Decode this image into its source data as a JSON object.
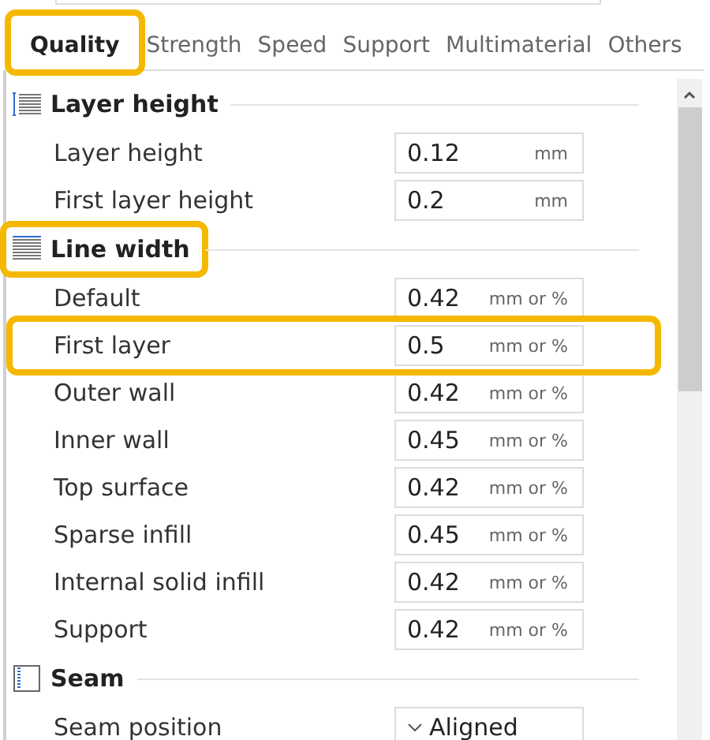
{
  "tabs": [
    {
      "label": "Quality",
      "selected": true,
      "highlighted": true
    },
    {
      "label": "Strength",
      "selected": false,
      "highlighted": false
    },
    {
      "label": "Speed",
      "selected": false,
      "highlighted": false
    },
    {
      "label": "Support",
      "selected": false,
      "highlighted": false
    },
    {
      "label": "Multimaterial",
      "selected": false,
      "highlighted": false
    },
    {
      "label": "Others",
      "selected": false,
      "highlighted": false
    }
  ],
  "sections": [
    {
      "title": "Layer height",
      "kind": "layers",
      "highlighted": false,
      "rows": [
        {
          "kind": "number",
          "label": "Layer height",
          "value": "0.12",
          "unit": "mm",
          "highlighted": false
        },
        {
          "kind": "number",
          "label": "First layer height",
          "value": "0.2",
          "unit": "mm",
          "highlighted": false
        }
      ]
    },
    {
      "title": "Line width",
      "kind": "lines",
      "highlighted": true,
      "rows": [
        {
          "kind": "number",
          "label": "Default",
          "value": "0.42",
          "unit": "mm or %",
          "highlighted": false
        },
        {
          "kind": "number",
          "label": "First layer",
          "value": "0.5",
          "unit": "mm or %",
          "highlighted": true
        },
        {
          "kind": "number",
          "label": "Outer wall",
          "value": "0.42",
          "unit": "mm or %",
          "highlighted": false
        },
        {
          "kind": "number",
          "label": "Inner wall",
          "value": "0.45",
          "unit": "mm or %",
          "highlighted": false
        },
        {
          "kind": "number",
          "label": "Top surface",
          "value": "0.42",
          "unit": "mm or %",
          "highlighted": false
        },
        {
          "kind": "number",
          "label": "Sparse infill",
          "value": "0.45",
          "unit": "mm or %",
          "highlighted": false
        },
        {
          "kind": "number",
          "label": "Internal solid infill",
          "value": "0.42",
          "unit": "mm or %",
          "highlighted": false
        },
        {
          "kind": "number",
          "label": "Support",
          "value": "0.42",
          "unit": "mm or %",
          "highlighted": false
        }
      ]
    },
    {
      "title": "Seam",
      "kind": "seam",
      "highlighted": false,
      "rows": [
        {
          "kind": "select",
          "label": "Seam position",
          "value": "Aligned",
          "highlighted": false
        }
      ]
    }
  ]
}
